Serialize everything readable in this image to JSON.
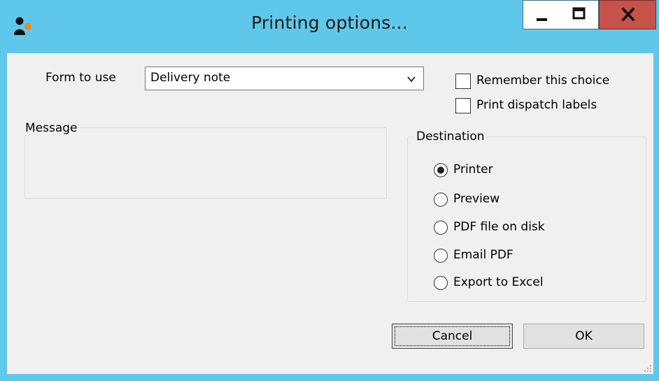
{
  "window": {
    "title": "Printing options...",
    "icons": {
      "app": "app-person-icon",
      "minimize": "minimize-icon",
      "maximize": "maximize-icon",
      "close": "close-icon"
    },
    "close_label": "x"
  },
  "form": {
    "form_to_use_label": "Form to use",
    "form_to_use_value": "Delivery note",
    "remember_choice_label": "Remember this choice",
    "remember_choice_checked": false,
    "print_dispatch_labels_label": "Print dispatch labels",
    "print_dispatch_labels_checked": false
  },
  "message": {
    "group_title": "Message",
    "text": ""
  },
  "destination": {
    "group_title": "Destination",
    "options": [
      {
        "label": "Printer",
        "checked": true
      },
      {
        "label": "Preview",
        "checked": false
      },
      {
        "label": "PDF file on disk",
        "checked": false
      },
      {
        "label": "Email PDF",
        "checked": false
      },
      {
        "label": "Export to Excel",
        "checked": false
      }
    ]
  },
  "buttons": {
    "cancel": "Cancel",
    "ok": "OK"
  },
  "colors": {
    "titlebar": "#5fc8ea",
    "close_button": "#c7514b",
    "dialog_bg": "#f0f0f0"
  }
}
